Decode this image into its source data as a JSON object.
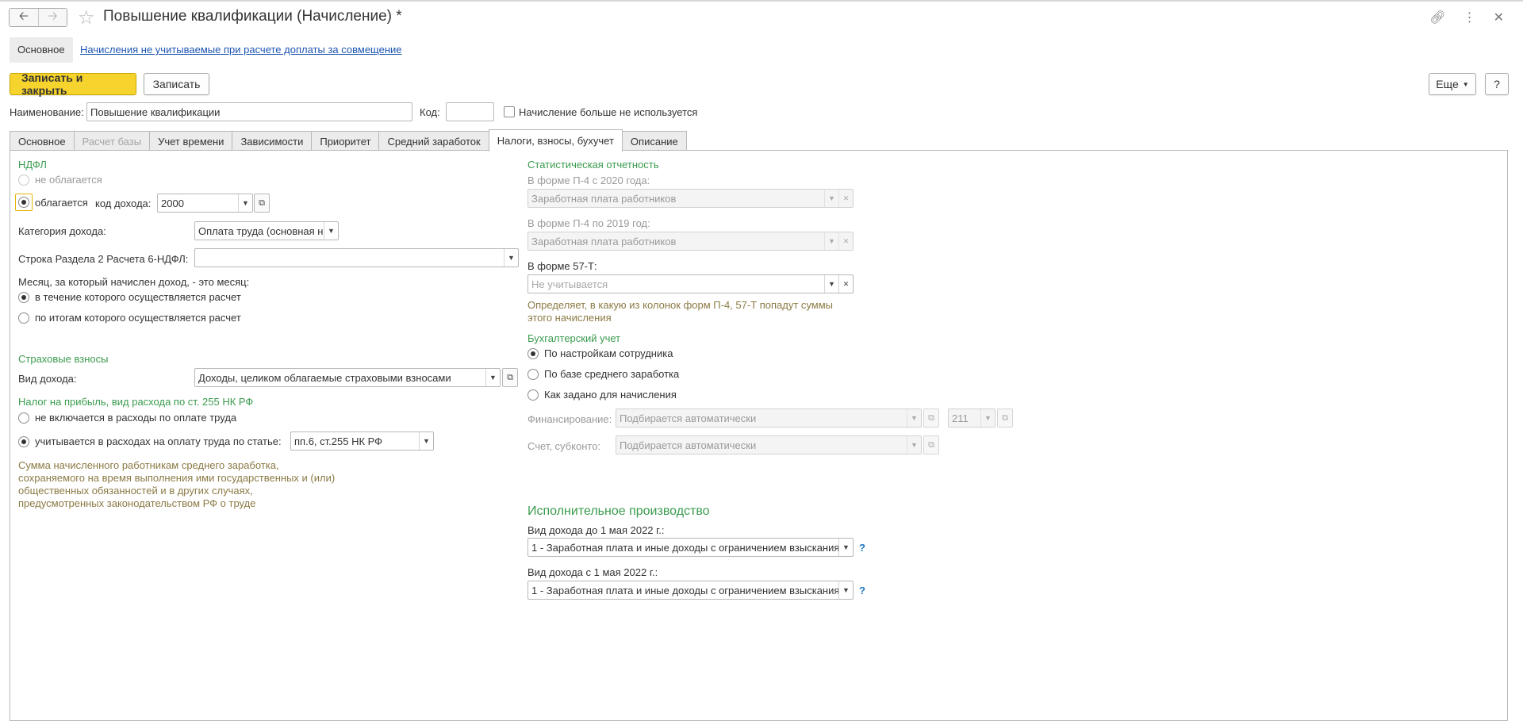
{
  "window": {
    "title": "Повышение квалификации (Начисление) *",
    "icons": [
      "link-icon",
      "more-icon",
      "close-icon"
    ]
  },
  "topnav": {
    "main_label": "Основное",
    "link_label": "Начисления не учитываемые при расчете доплаты за совмещение"
  },
  "toolbar": {
    "save_close": "Записать и закрыть",
    "save": "Записать",
    "more": "Еще",
    "help": "?"
  },
  "header": {
    "name_label": "Наименование:",
    "name_value": "Повышение квалификации",
    "code_label": "Код:",
    "code_value": "",
    "not_used_label": "Начисление больше не используется"
  },
  "tabs": [
    {
      "label": "Основное"
    },
    {
      "label": "Расчет базы"
    },
    {
      "label": "Учет времени"
    },
    {
      "label": "Зависимости"
    },
    {
      "label": "Приоритет"
    },
    {
      "label": "Средний заработок"
    },
    {
      "label": "Налоги, взносы, бухучет"
    },
    {
      "label": "Описание"
    }
  ],
  "ndfl": {
    "section": "НДФЛ",
    "not_taxed": "не облагается",
    "taxed": "облагается",
    "income_code_label": "код дохода:",
    "income_code_value": "2000",
    "category_label": "Категория дохода:",
    "category_value": "Оплата труда (основная н",
    "row_label": "Строка Раздела 2 Расчета 6-НДФЛ:",
    "row_value": "",
    "month_label": "Месяц, за который начислен доход, - это месяц:",
    "month_opt1": "в течение которого осуществляется расчет",
    "month_opt2": "по итогам которого осуществляется расчет"
  },
  "insurance": {
    "section": "Страховые взносы",
    "income_type_label": "Вид дохода:",
    "income_type_value": "Доходы, целиком облагаемые страховыми взносами"
  },
  "profit_tax": {
    "section": "Налог на прибыль, вид расхода по ст. 255 НК РФ",
    "opt1": "не включается в расходы по оплате труда",
    "opt2": "учитывается в расходах на оплату труда по статье:",
    "article_value": "пп.6, ст.255 НК РФ",
    "note": [
      "Сумма начисленного работникам среднего заработка,",
      "сохраняемого на время выполнения ими государственных и (или)",
      "общественных обязанностей и в других случаях,",
      "предусмотренных законодательством РФ о труде"
    ]
  },
  "stats": {
    "section": "Статистическая отчетность",
    "p4_2020_label": "В форме П-4 с 2020 года:",
    "p4_2020_value": "Заработная плата работников",
    "p4_2019_label": "В форме П-4 по 2019 год:",
    "p4_2019_value": "Заработная плата работников",
    "f57_label": "В форме 57-Т:",
    "f57_placeholder": "Не учитывается",
    "note": [
      "Определяет, в какую из колонок форм П-4, 57-Т попадут суммы",
      "этого начисления"
    ]
  },
  "accounting": {
    "section": "Бухгалтерский учет",
    "opt1": "По настройкам сотрудника",
    "opt2": "По базе среднего заработка",
    "opt3": "Как задано для начисления",
    "financing_label": "Финансирование:",
    "financing_placeholder": "Подбирается автоматически",
    "financing_code": "211",
    "account_label": "Счет, субконто:",
    "account_placeholder": "Подбирается автоматически"
  },
  "enforcement": {
    "section": "Исполнительное производство",
    "before_label": "Вид дохода до 1 мая 2022 г.:",
    "before_value": "1 - Заработная плата и иные доходы с ограничением взыскания",
    "after_label": "Вид дохода с 1 мая 2022 г.:",
    "after_value": "1 - Заработная плата и иные доходы с ограничением взыскания",
    "help": "?"
  },
  "colors": {
    "accent_yellow": "#f7d42d",
    "section_green": "#3a9b4e",
    "link_blue": "#1c55b1",
    "note_olive": "#8b7a44"
  }
}
